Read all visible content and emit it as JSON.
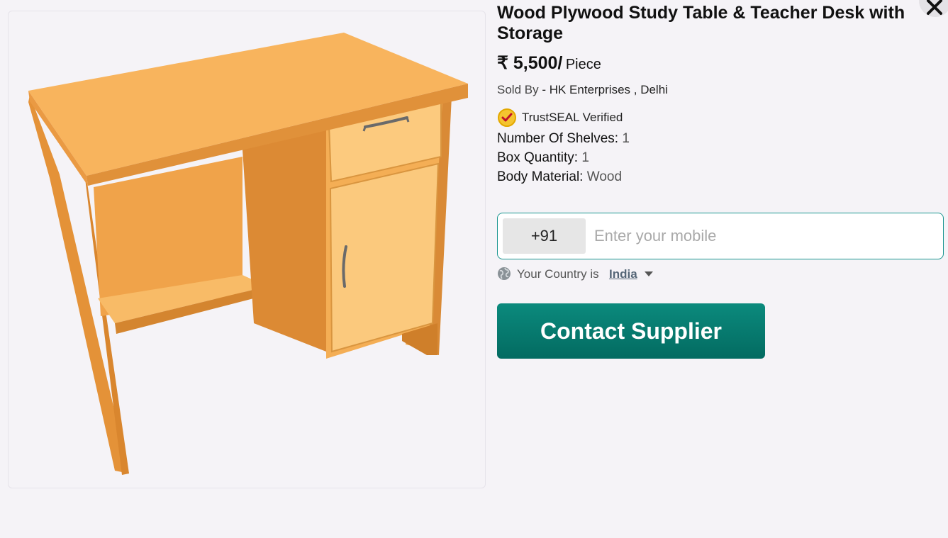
{
  "product": {
    "title": "Wood Plywood Study Table & Teacher Desk with Storage",
    "image_alt": "wooden study table with drawer and cabinet",
    "price": "₹ 5,500/",
    "unit": "Piece"
  },
  "seller": {
    "label": "Sold By",
    "name": "- HK Enterprises , Delhi"
  },
  "trust": {
    "label": "TrustSEAL Verified",
    "icon": "trustseal-badge-icon"
  },
  "specs": [
    {
      "key": "Number Of Shelves:",
      "value": "1"
    },
    {
      "key": "Box Quantity:",
      "value": "1"
    },
    {
      "key": "Body Material:",
      "value": "Wood"
    }
  ],
  "form": {
    "country_code": "+91",
    "mobile_placeholder": "Enter your mobile",
    "mobile_value": "",
    "country_label": "Your Country is",
    "country_name": "India",
    "submit_label": "Contact Supplier"
  },
  "colors": {
    "accent": "#067a6f",
    "input_border": "#1a9690",
    "background": "#f5f3f7"
  }
}
